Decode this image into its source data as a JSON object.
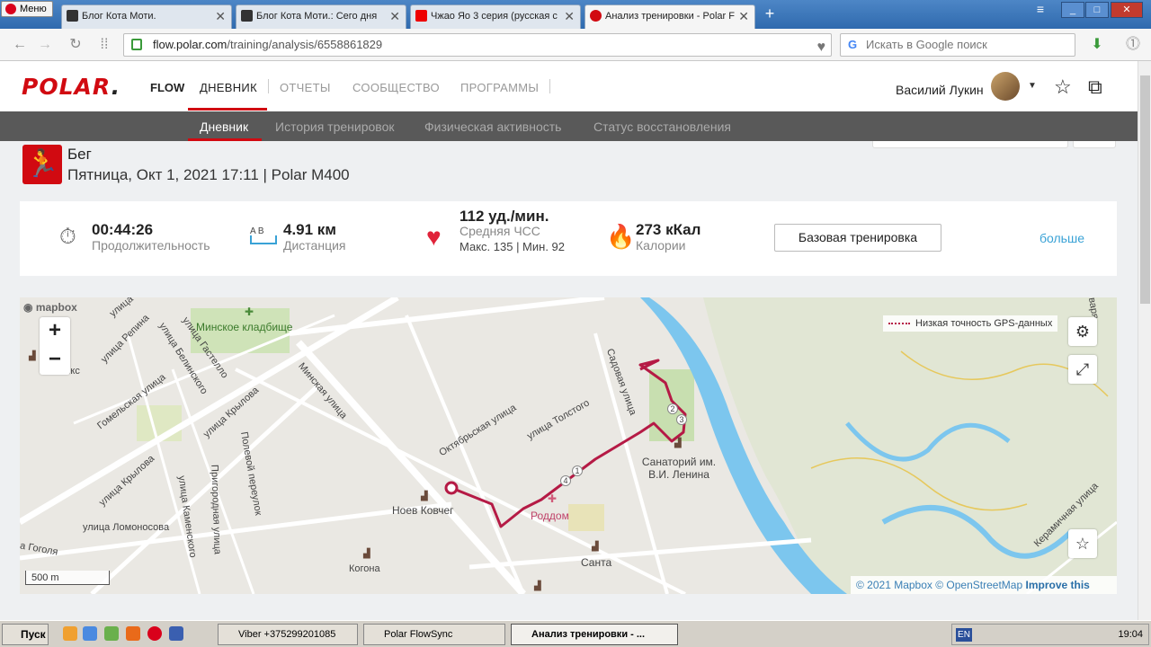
{
  "browser": {
    "menu_label": "Меню",
    "tabs": [
      {
        "label": "Блог Кота Моти.",
        "active": false
      },
      {
        "label": "Блог Кота Моти.: Сего дня",
        "active": false
      },
      {
        "label": "Чжао Яо 3 серия (русская с",
        "active": false
      },
      {
        "label": "Анализ тренировки - Polar F",
        "active": true
      }
    ],
    "url_host": "flow.polar.com",
    "url_path": "/training/analysis/6558861829",
    "search_placeholder": "Искать в Google поиск"
  },
  "header": {
    "logo": "POLAR",
    "logo_tm": ".",
    "flow": "FLOW",
    "nav": [
      "ДНЕВНИК",
      "ОТЧЕТЫ",
      "СООБЩЕСТВО",
      "ПРОГРАММЫ"
    ],
    "user_name": "Василий Лукин"
  },
  "subnav": [
    "Дневник",
    "История тренировок",
    "Физическая активность",
    "Статус восстановления"
  ],
  "training": {
    "sport": "Бег",
    "date_line": "Пятница, Окт 1, 2021 17:11 | Polar M400"
  },
  "summary": {
    "duration_value": "00:44:26",
    "duration_label": "Продолжительность",
    "distance_value": "4.91 км",
    "distance_label": "Дистанция",
    "distance_ab": "A   B",
    "hr_value": "112 уд./мин.",
    "hr_label": "Средняя ЧСС",
    "hr_minmax": "Макс. 135 | Мин. 92",
    "cal_value": "273 кКал",
    "cal_label": "Калории",
    "base_button": "Базовая тренировка",
    "more_link": "больше"
  },
  "map": {
    "provider_logo": "mapbox",
    "gps_legend": "Низкая точность GPS-данных",
    "scale": "500 m",
    "attrib_1": "© 2021 Mapbox",
    "attrib_2": "© OpenStreetMap",
    "attrib_3": "Improve this map",
    "labels": [
      "Минское кладбище",
      "улица Репина",
      "улица Гастелло",
      "улица Белинского",
      "Гомельская улица",
      "улица Крылова",
      "Минская улица",
      "Полевой переулок",
      "улица Крылова",
      "Пригородная улица",
      "улица Каменского",
      "улица Ломоносова",
      "а Гоголя",
      "Октябрьская улица",
      "улица Толстого",
      "Садовая улица",
      "Ноев Ковчег",
      "Роддом",
      "Санаторий им. В.И. Ленина",
      "Санта",
      "Керамичная улица",
      "Когона",
      "улица",
      "лкс",
      "варя"
    ],
    "markers": [
      "2",
      "3",
      "4",
      "1"
    ],
    "colors": {
      "route": "#b51a45",
      "river": "#7cc6ee",
      "green": "#c8dfb0"
    }
  },
  "taskbar": {
    "start": "Пуск",
    "tasks": [
      "Viber +375299201085",
      "Polar FlowSync",
      "Анализ тренировки - ..."
    ],
    "lang": "EN",
    "clock": "19:04"
  }
}
